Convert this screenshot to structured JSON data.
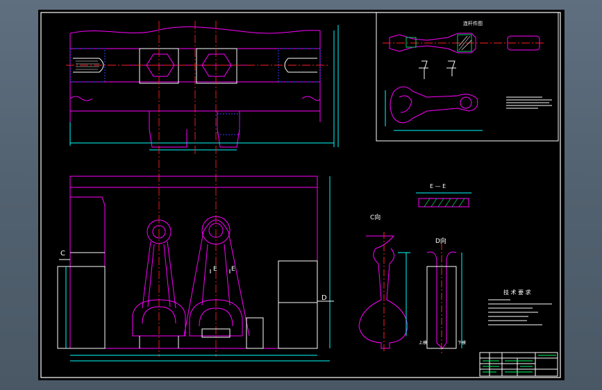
{
  "colors": {
    "background": "#000000",
    "frame": "#ffffff",
    "part_outline": "#ff00ff",
    "center_line": "#ff2020",
    "dimension": "#00ffff",
    "hidden_line": "#3344ff",
    "section_hatch": "#00cc66",
    "text": "#ffffff",
    "title_block": "#00ff66"
  },
  "views": {
    "section_ee": "E — E",
    "view_c": "C向",
    "view_d": "D向",
    "marker_c": "C",
    "marker_d": "D",
    "marker_e1": "E",
    "marker_e2": "E",
    "detail_title": "连杆件图",
    "bottom_label_left": "上模",
    "bottom_label_right": "下模"
  },
  "technical_requirements": {
    "title": "技 术 要 求"
  }
}
